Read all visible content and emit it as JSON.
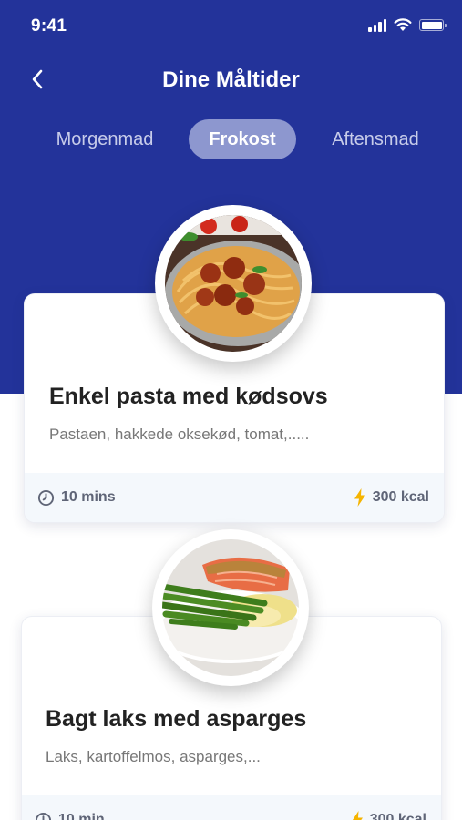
{
  "status_bar": {
    "time": "9:41"
  },
  "header": {
    "title": "Dine Måltider"
  },
  "tabs": [
    {
      "label": "Morgenmad",
      "active": false
    },
    {
      "label": "Frokost",
      "active": true
    },
    {
      "label": "Aftensmad",
      "active": false
    }
  ],
  "meals": [
    {
      "title": "Enkel pasta med kødsovs",
      "description": "Pastaen, hakkede oksekød, tomat,.....",
      "time": "10 mins",
      "calories": "300 kcal"
    },
    {
      "title": "Bagt laks med asparges",
      "description": "Laks, kartoffelmos, asparges,...",
      "time": "10 min",
      "calories": "300 kcal"
    }
  ],
  "colors": {
    "primary": "#23339a",
    "active_tab": "#8d97cf",
    "accent_bolt": "#f5b400",
    "footer_bg": "#f4f8fc"
  }
}
